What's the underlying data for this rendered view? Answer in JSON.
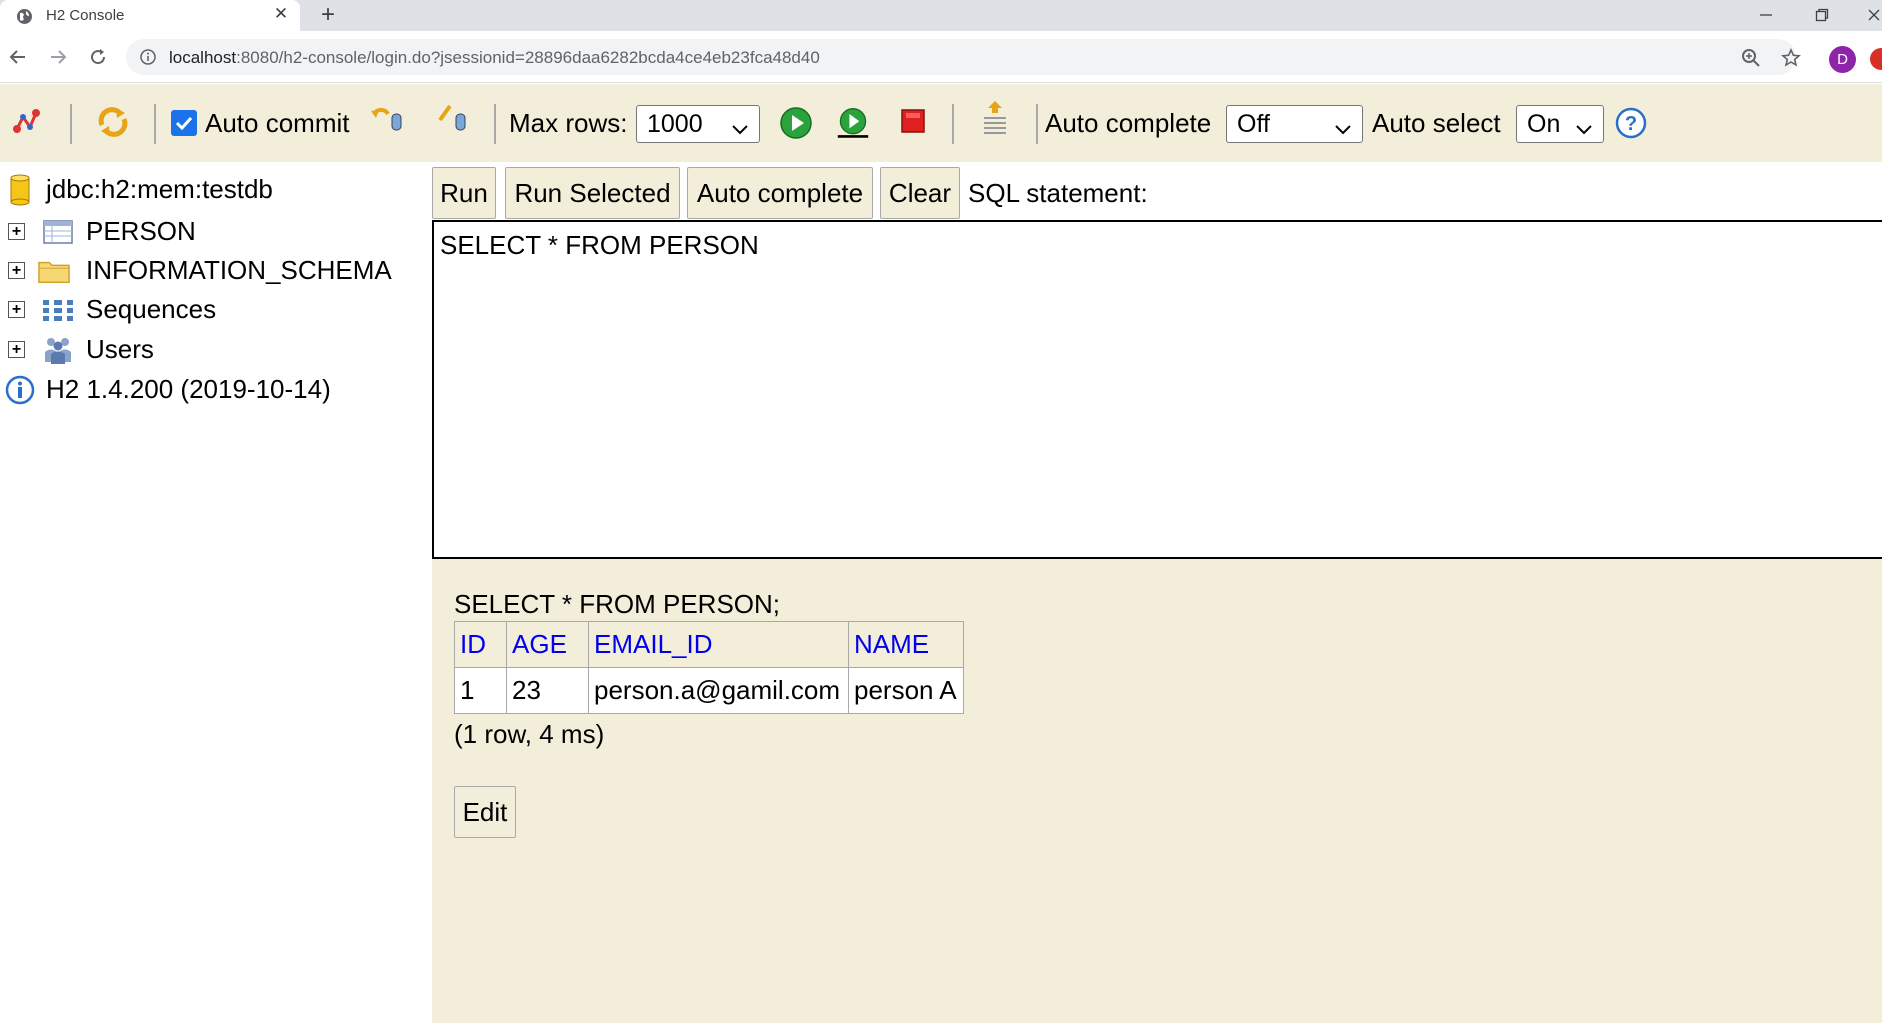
{
  "browser": {
    "tab_title": "H2 Console",
    "url_host": "localhost",
    "url_rest": ":8080/h2-console/login.do?jsessionid=28896daa6282bcda4ce4eb23fca48d40",
    "profile_initial": "D"
  },
  "toolbar": {
    "auto_commit_label": "Auto commit",
    "auto_commit_checked": true,
    "max_rows_label": "Max rows:",
    "max_rows_value": "1000",
    "auto_complete_label": "Auto complete",
    "auto_complete_value": "Off",
    "auto_select_label": "Auto select",
    "auto_select_value": "On"
  },
  "tree": {
    "connection": "jdbc:h2:mem:testdb",
    "items": [
      {
        "label": "PERSON",
        "icon": "table-icon"
      },
      {
        "label": "INFORMATION_SCHEMA",
        "icon": "folder-icon"
      },
      {
        "label": "Sequences",
        "icon": "sequences-icon"
      },
      {
        "label": "Users",
        "icon": "users-icon"
      }
    ],
    "version": "H2 1.4.200 (2019-10-14)"
  },
  "query": {
    "run_label": "Run",
    "run_selected_label": "Run Selected",
    "auto_complete_label": "Auto complete",
    "clear_label": "Clear",
    "sql_statement_label": "SQL statement:",
    "sql_text": "SELECT * FROM PERSON"
  },
  "results": {
    "statement": "SELECT * FROM PERSON;",
    "columns": [
      "ID",
      "AGE",
      "EMAIL_ID",
      "NAME"
    ],
    "rows": [
      [
        "1",
        "23",
        "person.a@gamil.com",
        "person A"
      ]
    ],
    "meta": "(1 row, 4 ms)",
    "edit_label": "Edit"
  },
  "colors": {
    "panel_bg": "#f2eeda",
    "link_blue": "#0000ee",
    "checkbox_blue": "#1a73e8"
  }
}
